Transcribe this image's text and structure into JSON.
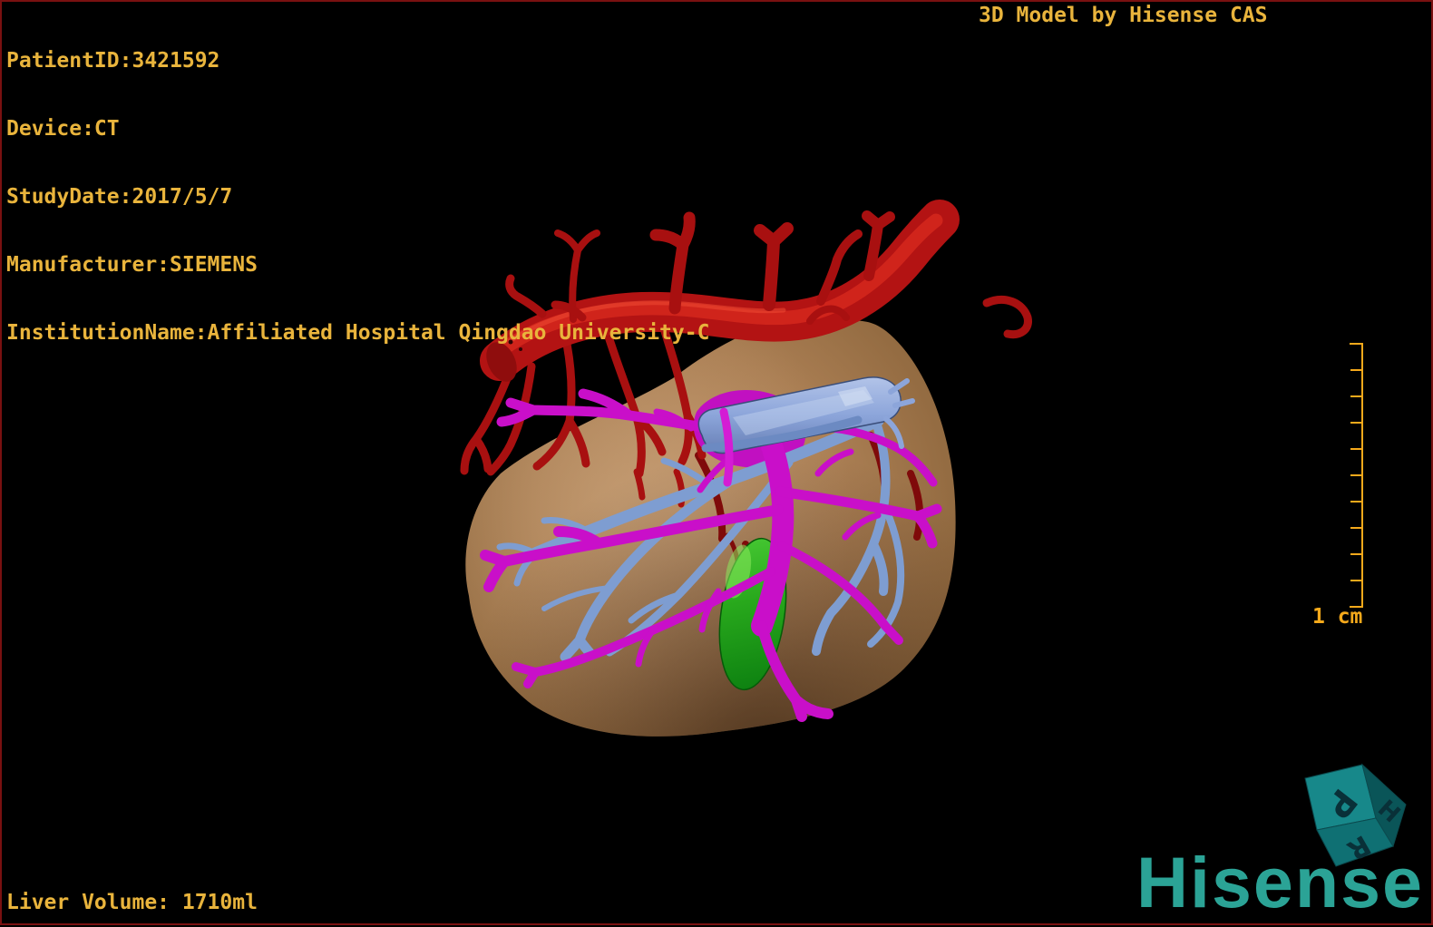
{
  "header": {
    "patient_lines": [
      "PatientID:3421592",
      "Device:CT",
      "StudyDate:2017/5/7",
      "Manufacturer:SIEMENS",
      "InstitutionName:Affiliated Hospital Qingdao University-C"
    ],
    "title": "3D Model by Hisense CAS"
  },
  "footer": {
    "liver_volume": "Liver Volume: 1710ml"
  },
  "scale_bar": {
    "label": "1 cm",
    "tick_count": 10,
    "orientation": "vertical"
  },
  "orientation_cube": {
    "letters": {
      "top": "P",
      "right": "H",
      "bottom": "R"
    },
    "face_colors": {
      "top": "#17888A",
      "right": "#0A5558",
      "bottom": "#0F7073"
    }
  },
  "branding": {
    "logo_text": "Hisense",
    "logo_color": "#2BA396"
  },
  "annotation": {
    "text_color": "#E9B43C",
    "scale_color": "#F5A91B",
    "border_color": "#7A1111",
    "background_color": "#000000"
  },
  "model": {
    "structures": [
      {
        "name": "liver",
        "color": "#AA7E53"
      },
      {
        "name": "hepatic-artery",
        "color": "#A81010"
      },
      {
        "name": "portal-vein",
        "color": "#C90FC9"
      },
      {
        "name": "hepatic-vein",
        "color": "#7E9DD1"
      },
      {
        "name": "inferior-vena-cava",
        "color": "#8CA5DA"
      },
      {
        "name": "gallbladder",
        "color": "#28A81C"
      }
    ]
  }
}
